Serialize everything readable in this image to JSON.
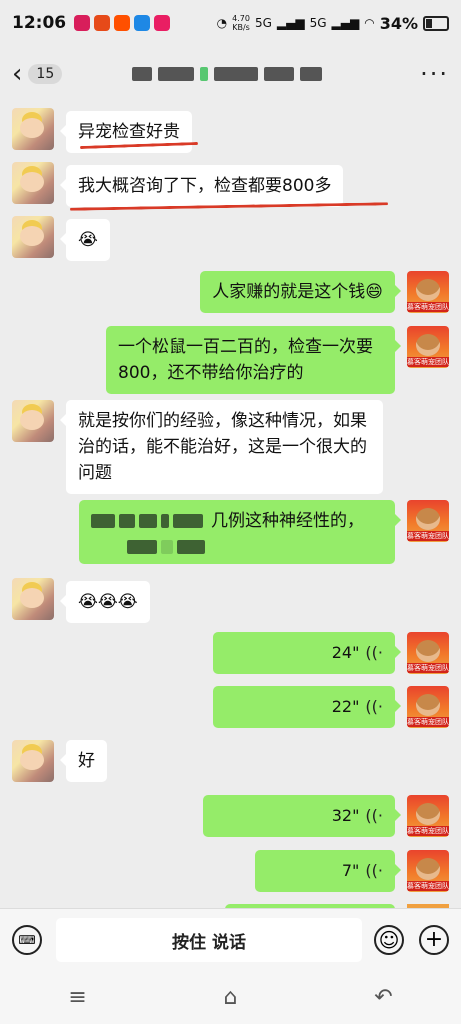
{
  "status": {
    "time": "12:06",
    "app_icon_colors": [
      "#d81e5b",
      "#e64a19",
      "#ff5000",
      "#1e88e5",
      "#e91e63"
    ],
    "speed_value": "4.70",
    "speed_unit": "KB/s",
    "network": "5G",
    "battery": "34%"
  },
  "header": {
    "unread_count": "15",
    "more_icon": "more-dots-icon"
  },
  "messages": [
    {
      "side": "left",
      "type": "text",
      "text": "异宠检查好贵"
    },
    {
      "side": "left",
      "type": "text",
      "text": "我大概咨询了下，检查都要800多"
    },
    {
      "side": "left",
      "type": "emoji",
      "text": "😭"
    },
    {
      "side": "right",
      "type": "text",
      "text": "人家赚的就是这个钱😄"
    },
    {
      "side": "right",
      "type": "text",
      "text": "一个松鼠一百二百的，检查一次要800，还不带给你治疗的"
    },
    {
      "side": "left",
      "type": "text",
      "text": "就是按你们的经验，像这种情况，如果治的话，能不能治好，这是一个很大的问题"
    },
    {
      "side": "right",
      "type": "text",
      "text": "几例这种神经性的，"
    },
    {
      "side": "left",
      "type": "emoji",
      "text": "😭😭😭"
    },
    {
      "side": "right",
      "type": "voice",
      "text": "24\""
    },
    {
      "side": "right",
      "type": "voice",
      "text": "22\""
    },
    {
      "side": "left",
      "type": "text",
      "text": "好"
    },
    {
      "side": "right",
      "type": "voice",
      "text": "32\""
    },
    {
      "side": "right",
      "type": "voice",
      "text": "7\""
    }
  ],
  "avatar_label_right": "慕客萌宠团队",
  "input": {
    "hold_to_talk": "按住 说话"
  },
  "colors": {
    "self_bubble": "#95ec69",
    "other_bubble": "#ffffff",
    "annotation": "#d93a27"
  }
}
